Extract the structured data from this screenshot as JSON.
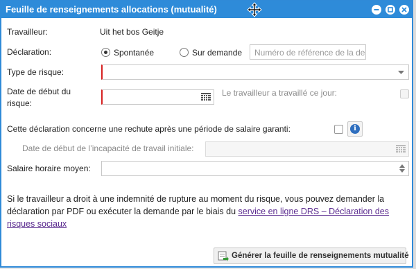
{
  "window": {
    "title": "Feuille de renseignements allocations (mutualité)"
  },
  "form": {
    "worker_label": "Travailleur:",
    "worker_value": "Uit het bos Geitje",
    "declaration_label": "Déclaration:",
    "radio_spontaneous": "Spontanée",
    "radio_on_request": "Sur demande",
    "reference_placeholder": "Numéro de référence de la demande",
    "risk_type_label": "Type de risque:",
    "risk_type_value": "",
    "start_date_label_1": "Date de début du",
    "start_date_label_2": "risque:",
    "worked_that_day_label": "Le travailleur a travaillé ce jour:",
    "relapse_label": "Cette déclaration concerne une rechute après une période de salaire garanti:",
    "incapacity_start_label": "Date de début de l’incapacité de travail initiale:",
    "hourly_wage_label": "Salaire horaire moyen:"
  },
  "info": {
    "text_before": "Si le travailleur a droit à une indemnité de rupture au moment du risque, vous pouvez demander la déclaration par PDF ou exécuter la demande par le biais du ",
    "link": "service en ligne DRS – Déclaration des risques sociaux"
  },
  "buttons": {
    "generate": "Générer la feuille de renseignements mutualité"
  },
  "icons": {
    "move": "move-cursor-icon",
    "minimize": "minimize-icon",
    "maximize": "maximize-icon",
    "close": "close-icon",
    "calendar": "calendar-icon",
    "dropdown": "chevron-down-icon",
    "info": "info-icon",
    "generate": "document-generate-icon"
  },
  "colors": {
    "titlebar": "#2e8bd9",
    "required": "#d62020",
    "link": "#5b2b8f"
  }
}
